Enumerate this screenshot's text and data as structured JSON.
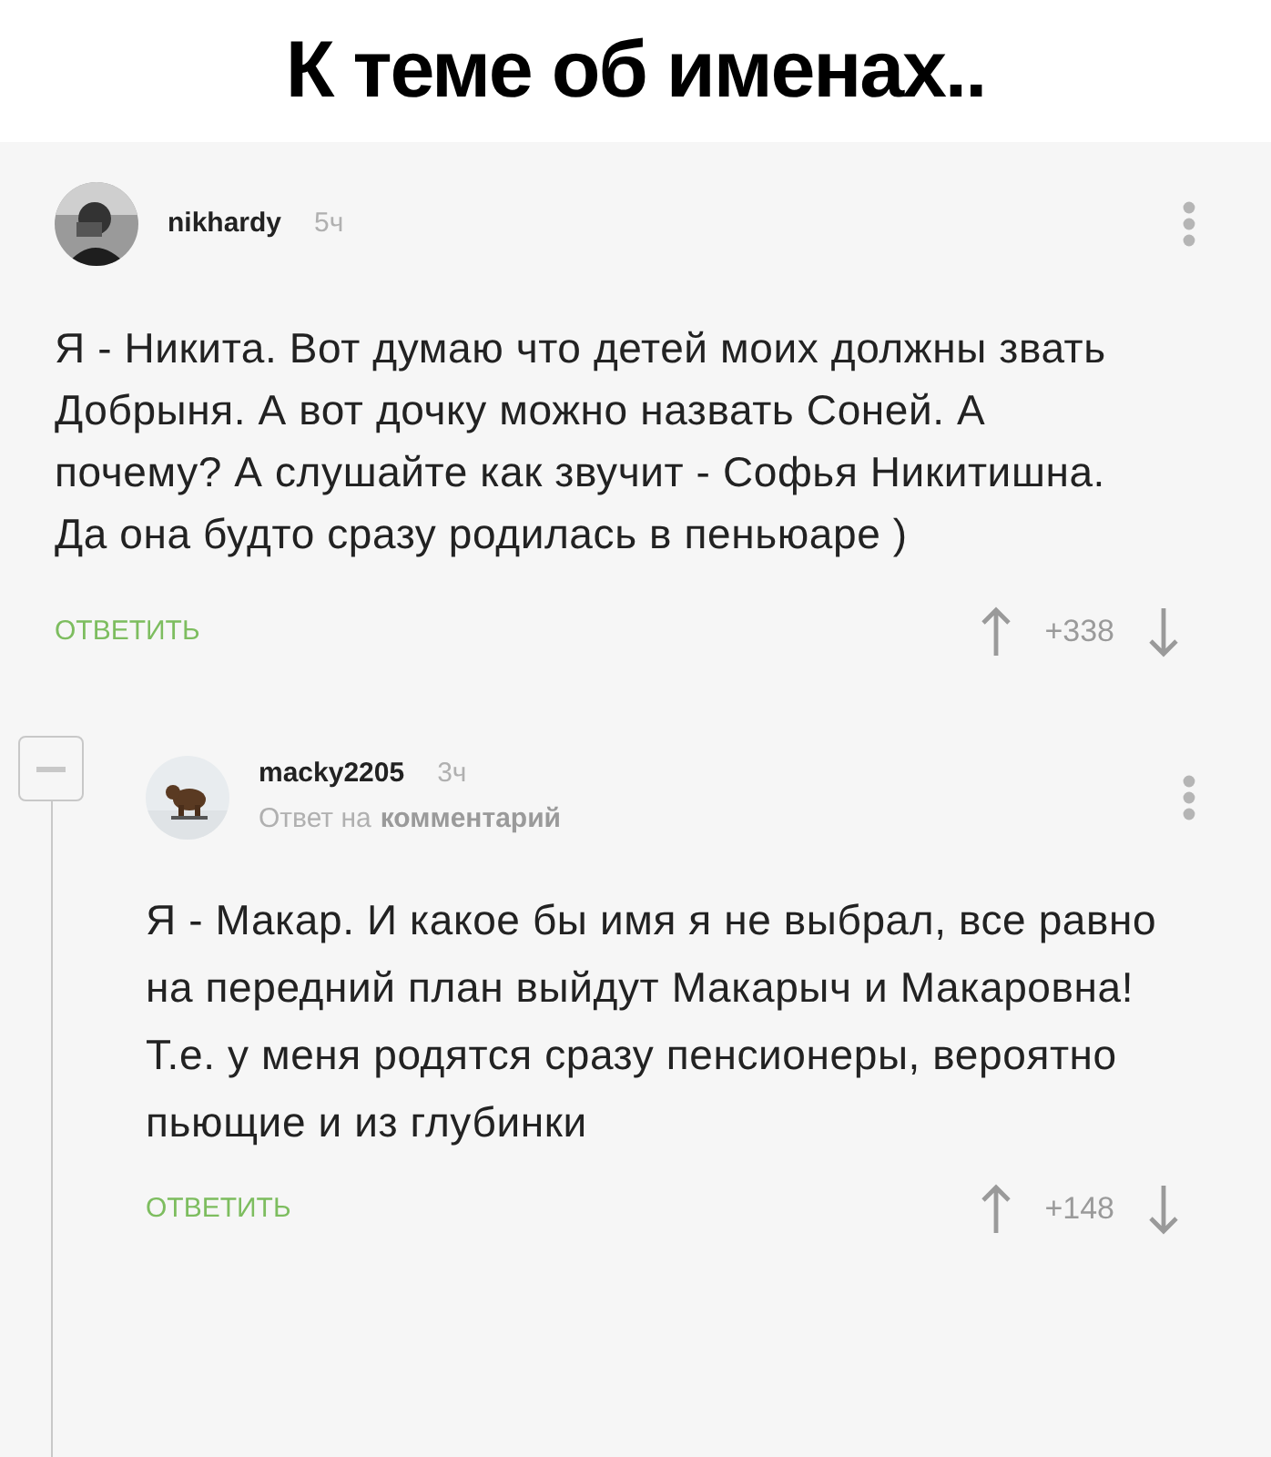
{
  "title": "К теме об именах..",
  "comments": [
    {
      "author": "nikhardy",
      "time": "5ч",
      "paragraphs": [
        "Я - Никита. Вот думаю что детей моих должны звать Добрыня. А вот дочку можно назвать Соней. А почему? А слушайте как звучит - Софья Никитишна.",
        "Да она будто сразу родилась в пеньюаре )"
      ],
      "reply_label": "ОТВЕТИТЬ",
      "rating": "+338"
    },
    {
      "author": "macky2205",
      "time": "3ч",
      "reply_to": {
        "prefix": "Ответ на",
        "target": "комментарий"
      },
      "paragraphs": [
        "Я - Макар. И какое бы имя я не выбрал, все равно на передний план выйдут Макарыч и Макаровна! Т.е. у меня родятся сразу пенсионеры, вероятно пьющие и из глубинки"
      ],
      "reply_label": "ОТВЕТИТЬ",
      "rating": "+148"
    }
  ]
}
